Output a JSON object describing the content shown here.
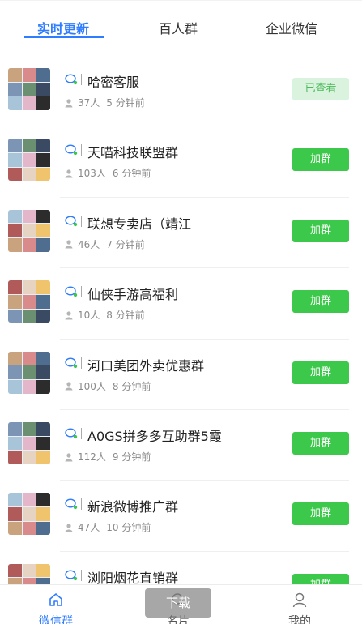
{
  "tabs": [
    {
      "label": "实时更新",
      "active": true
    },
    {
      "label": "百人群",
      "active": false
    },
    {
      "label": "企业微信",
      "active": false
    }
  ],
  "groups": [
    {
      "name": "哈密客服",
      "members": "37人",
      "time": "5 分钟前",
      "action": "已查看"
    },
    {
      "name": "天喵科技联盟群",
      "members": "103人",
      "time": "6 分钟前",
      "action": "加群"
    },
    {
      "name": "联想专卖店（靖江",
      "members": "46人",
      "time": "7 分钟前",
      "action": "加群"
    },
    {
      "name": "仙侠手游高福利",
      "members": "10人",
      "time": "8 分钟前",
      "action": "加群"
    },
    {
      "name": "河口美团外卖优惠群",
      "members": "100人",
      "time": "8 分钟前",
      "action": "加群"
    },
    {
      "name": "A0GS拼多多互助群5霞",
      "members": "112人",
      "time": "9 分钟前",
      "action": "加群"
    },
    {
      "name": "新浪微博推广群",
      "members": "47人",
      "time": "10 分钟前",
      "action": "加群"
    },
    {
      "name": "浏阳烟花直销群",
      "members": "",
      "time": "",
      "action": "加群"
    }
  ],
  "bottom_nav": [
    {
      "label": "微信群",
      "icon": "home-icon",
      "active": true
    },
    {
      "label": "名片",
      "icon": "card-icon",
      "active": false
    },
    {
      "label": "我的",
      "icon": "user-icon",
      "active": false
    }
  ],
  "download_label": "下载",
  "colors": {
    "accent": "#2e7cff",
    "join_button": "#3cc84a",
    "viewed_button_bg": "#daf3de",
    "viewed_button_text": "#4cb85a"
  }
}
